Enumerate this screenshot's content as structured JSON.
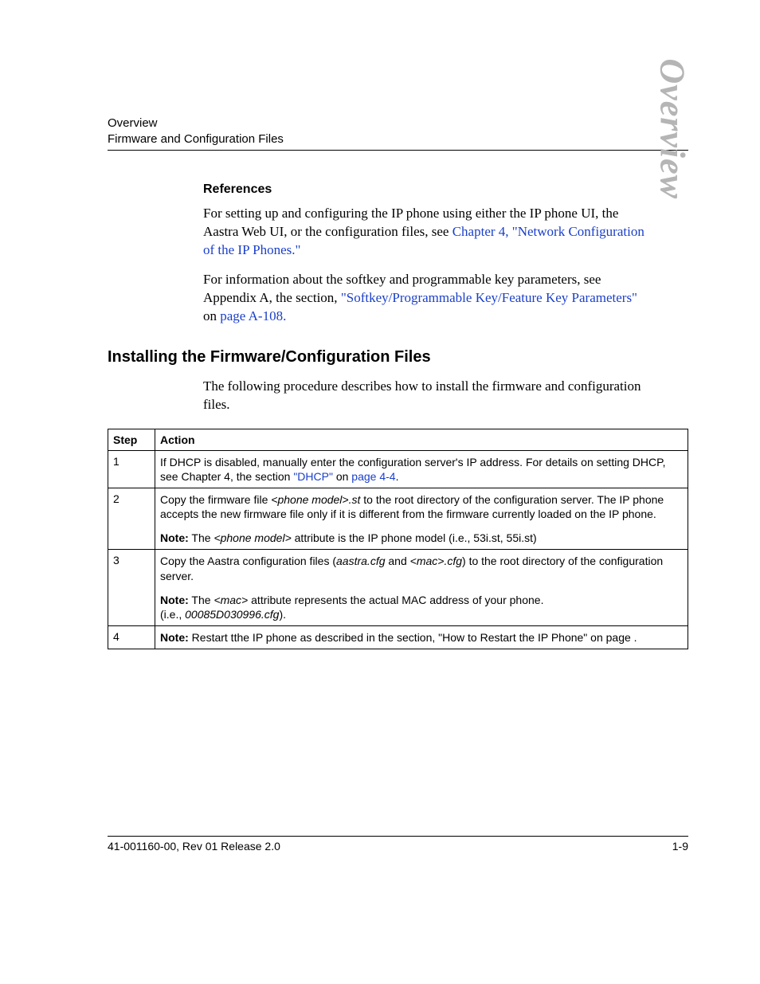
{
  "header": {
    "line1": "Overview",
    "line2": "Firmware and Configuration Files"
  },
  "side_label": "Overview",
  "references": {
    "heading": "References",
    "para1_a": "For setting up and configuring the IP phone using either the IP phone UI, the Aastra Web UI, or the configuration files, see ",
    "para1_link": "Chapter 4, \"Network Configuration of the IP Phones.\"",
    "para2_a": "For information about the softkey and programmable key parameters, see Appendix A, the section, ",
    "para2_link1": "\"Softkey/Programmable Key/Feature Key Parameters\"",
    "para2_b": " on ",
    "para2_link2": "page A-108."
  },
  "install": {
    "heading": "Installing the Firmware/Configuration Files",
    "intro": "The following procedure describes how to install the firmware and configuration files."
  },
  "table": {
    "head_step": "Step",
    "head_action": "Action",
    "rows": [
      {
        "step": "1",
        "p1_a": "If DHCP is disabled, manually enter the configuration server's IP address. For details on setting DHCP, see Chapter 4, the section ",
        "p1_link": "\"DHCP\"",
        "p1_b": " on ",
        "p1_link2": "page 4-4",
        "p1_c": "."
      },
      {
        "step": "2",
        "p1_a": "Copy the firmware file ",
        "p1_i": "<phone model>.st",
        "p1_b": " to the root directory of the configuration server. The IP phone accepts the new firmware file only if it is different from the firmware currently loaded on the IP phone.",
        "p2_bold": "Note:",
        "p2_a": " The ",
        "p2_i": "<phone model>",
        "p2_b": " attribute is the IP phone model (i.e., 53i.st, 55i.st)"
      },
      {
        "step": "3",
        "p1_a": "Copy the Aastra configuration files (",
        "p1_i1": "aastra.cfg",
        "p1_b": " and ",
        "p1_i2": "<mac>.cfg",
        "p1_c": ") to the root directory of the configuration server.",
        "p2_bold": "Note:",
        "p2_a": " The ",
        "p2_i": "<mac>",
        "p2_b": " attribute represents the actual MAC address of your phone.",
        "p3_a": "(i.e., ",
        "p3_i": "00085D030996.cfg",
        "p3_b": ")."
      },
      {
        "step": "4",
        "p1_bold": "Note:",
        "p1_a": " Restart tthe IP phone as described in the section, \"How to Restart the IP Phone\" on page ."
      }
    ]
  },
  "footer": {
    "left": "41-001160-00, Rev 01  Release 2.0",
    "right": "1-9"
  }
}
